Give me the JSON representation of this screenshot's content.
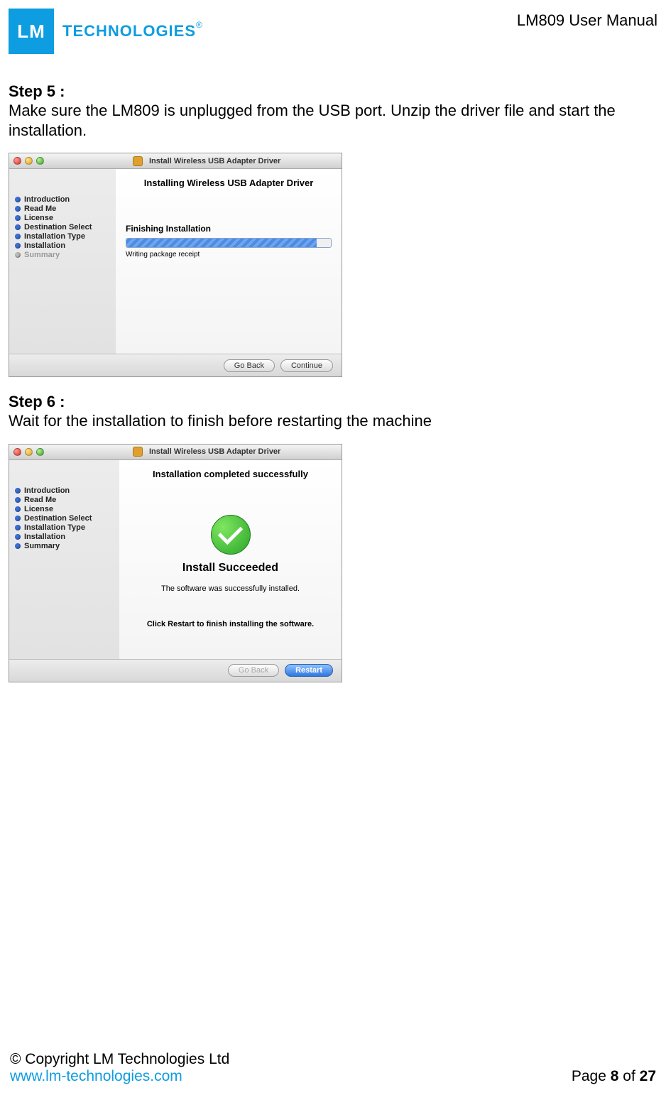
{
  "header": {
    "logo_square": "LM",
    "logo_text": "TECHNOLOGIES",
    "doc_title": "LM809 User Manual"
  },
  "step5": {
    "heading": "Step 5 :",
    "body": "Make sure the LM809 is unplugged from the USB port. Unzip the driver file and start the installation."
  },
  "step6": {
    "heading": "Step 6 :",
    "body": "Wait for the installation to finish before restarting the machine"
  },
  "installer1": {
    "window_title": "Install Wireless USB Adapter Driver",
    "heading": "Installing Wireless USB Adapter Driver",
    "sidebar": [
      "Introduction",
      "Read Me",
      "License",
      "Destination Select",
      "Installation Type",
      "Installation",
      "Summary"
    ],
    "sidebar_dimmed_index": 6,
    "stage_label": "Finishing Installation",
    "status": "Writing package receipt",
    "buttons": {
      "back": "Go Back",
      "continue": "Continue"
    }
  },
  "installer2": {
    "window_title": "Install Wireless USB Adapter Driver",
    "heading": "Installation completed successfully",
    "sidebar": [
      "Introduction",
      "Read Me",
      "License",
      "Destination Select",
      "Installation Type",
      "Installation",
      "Summary"
    ],
    "success_title": "Install Succeeded",
    "success_sub": "The software was successfully installed.",
    "success_note": "Click Restart to finish installing the software.",
    "buttons": {
      "back": "Go Back",
      "restart": "Restart"
    }
  },
  "footer": {
    "copyright": "© Copyright LM Technologies Ltd",
    "url": "www.lm-technologies.com",
    "page_prefix": "Page ",
    "page_num": "8",
    "page_mid": " of ",
    "page_total": "27"
  }
}
